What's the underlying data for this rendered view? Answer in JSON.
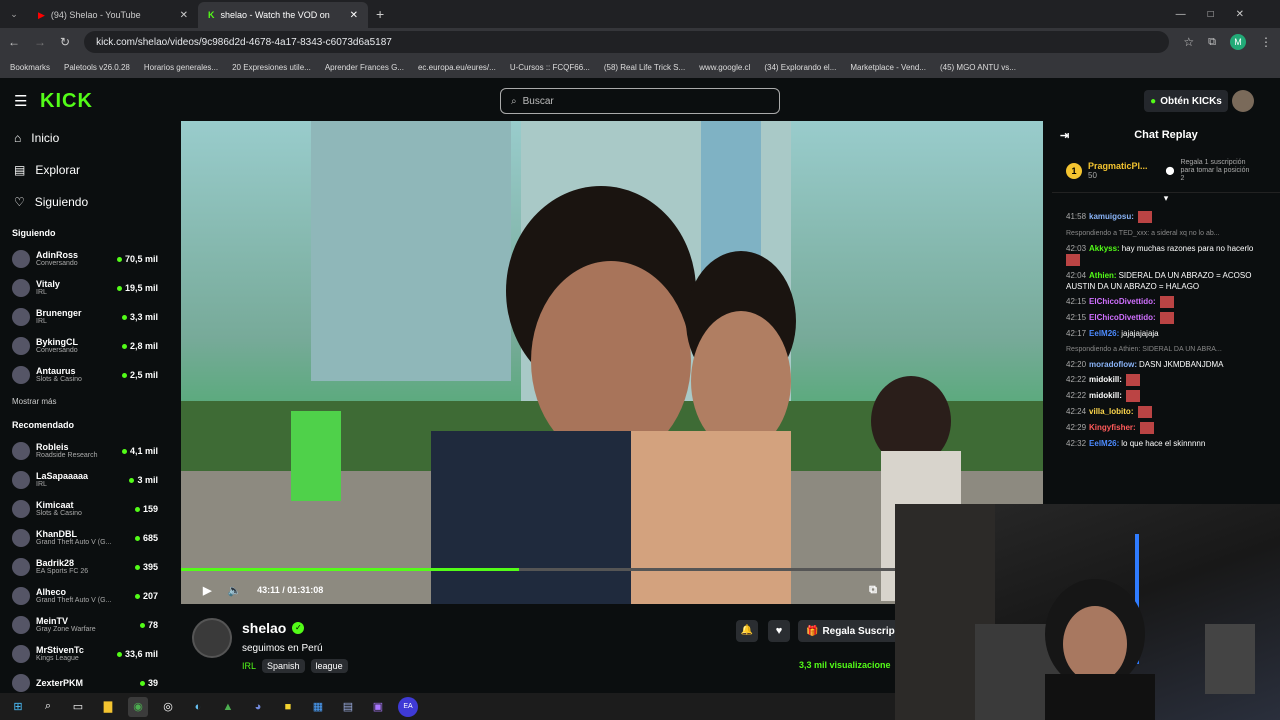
{
  "browser": {
    "tabs": [
      {
        "label": "(94) Shelao - YouTube",
        "icon": "youtube-icon"
      },
      {
        "label": "shelao - Watch the VOD on",
        "icon": "kick-icon"
      }
    ],
    "url": "kick.com/shelao/videos/9c986d2d-4678-4a17-8343-c6073d6a5187",
    "bookmarks": [
      "Bookmarks",
      "Paletools v26.0.28",
      "Horarios generales...",
      "20 Expresiones utile...",
      "Aprender Frances G...",
      "ec.europa.eu/eures/...",
      "U-Cursos :: FCQF66...",
      "(58) Real Life Trick S...",
      "www.google.cl",
      "(34) Explorando el...",
      "Marketplace - Vend...",
      "(45) MGO ANTU vs..."
    ]
  },
  "header": {
    "logo": "KICK",
    "search_placeholder": "Buscar",
    "get_kicks": "Obtén KICKs"
  },
  "sidebar": {
    "nav": [
      {
        "label": "Inicio",
        "icon": "home-icon"
      },
      {
        "label": "Explorar",
        "icon": "explore-icon"
      },
      {
        "label": "Siguiendo",
        "icon": "heart-icon"
      }
    ],
    "following_title": "Siguiendo",
    "following": [
      {
        "name": "AdinRoss",
        "sub": "Conversando",
        "viewers": "70,5 mil"
      },
      {
        "name": "Vitaly",
        "sub": "IRL",
        "viewers": "19,5 mil"
      },
      {
        "name": "Brunenger",
        "sub": "IRL",
        "viewers": "3,3 mil"
      },
      {
        "name": "BykingCL",
        "sub": "Conversando",
        "viewers": "2,8 mil"
      },
      {
        "name": "Antaurus",
        "sub": "Slots & Casino",
        "viewers": "2,5 mil"
      }
    ],
    "show_more": "Mostrar más",
    "recommended_title": "Recomendado",
    "recommended": [
      {
        "name": "Robleis",
        "sub": "Roadside Research",
        "viewers": "4,1 mil"
      },
      {
        "name": "LaSapaaaaa",
        "sub": "IRL",
        "viewers": "3 mil"
      },
      {
        "name": "Kimicaat",
        "sub": "Slots & Casino",
        "viewers": "159"
      },
      {
        "name": "KhanDBL",
        "sub": "Grand Theft Auto V (G...",
        "viewers": "685"
      },
      {
        "name": "Badrik28",
        "sub": "EA Sports FC 26",
        "viewers": "395"
      },
      {
        "name": "Alheco",
        "sub": "Grand Theft Auto V (G...",
        "viewers": "207"
      },
      {
        "name": "MeinTV",
        "sub": "Gray Zone Warfare",
        "viewers": "78"
      },
      {
        "name": "MrStivenTc",
        "sub": "Kings League",
        "viewers": "33,6 mil"
      },
      {
        "name": "ZexterPKM",
        "sub": "",
        "viewers": "39"
      }
    ]
  },
  "player": {
    "time": "43:11 / 01:31:08",
    "progress": 0.474
  },
  "stream": {
    "channel": "shelao",
    "title": "seguimos en Perú",
    "category": "IRL",
    "tags": [
      "Spanish",
      "league"
    ],
    "gift_button": "Regala Suscrip",
    "viewers": "3,3 mil visualizacione"
  },
  "chat": {
    "title": "Chat Replay",
    "pinned_user": "PragmaticPl...",
    "pinned_amount": "50",
    "pinned_rank": "1",
    "pinned_info": "Regala 1 suscripción para tomar la posición 2",
    "messages": [
      {
        "time": "41:58",
        "user": "kamuigosu:",
        "text": "",
        "color": "#8ab4f8",
        "emote": true
      },
      {
        "reply": "Respondiendo a TED_xxx: a sideral xq no lo ab..."
      },
      {
        "time": "42:03",
        "user": "Akkyss:",
        "text": "hay muchas razones para no hacerlo",
        "color": "#53fc18",
        "emote": true
      },
      {
        "time": "42:04",
        "user": "Athien:",
        "text": "SIDERAL DA UN ABRAZO = ACOSO AUSTIN DA UN ABRAZO = HALAGO",
        "color": "#53fc18"
      },
      {
        "time": "42:15",
        "user": "ElChicoDivettido:",
        "text": "",
        "color": "#d070ff",
        "emote": true
      },
      {
        "time": "42:15",
        "user": "ElChicoDivettido:",
        "text": "",
        "color": "#d070ff",
        "emote": true
      },
      {
        "time": "42:17",
        "user": "EelM26:",
        "text": "jajajajajaja",
        "color": "#4d8bff"
      },
      {
        "reply": "Respondiendo a Athien: SIDERAL DA UN ABRA..."
      },
      {
        "time": "42:20",
        "user": "moradoflow:",
        "text": "DASN JKMDBANJDMA",
        "color": "#8ab4f8"
      },
      {
        "time": "42:22",
        "user": "midokill:",
        "text": "",
        "color": "#fff",
        "emote": true
      },
      {
        "time": "42:22",
        "user": "midokill:",
        "text": "",
        "color": "#fff",
        "emote": true
      },
      {
        "time": "42:24",
        "user": "villa_lobito:",
        "text": "",
        "color": "#ffd84d",
        "emote": true
      },
      {
        "time": "42:29",
        "user": "Kingyfisher:",
        "text": "",
        "color": "#ff5a5a",
        "emote": true
      },
      {
        "time": "42:32",
        "user": "EelM26:",
        "text": "lo que hace el skinnnnn",
        "color": "#4d8bff"
      }
    ]
  }
}
